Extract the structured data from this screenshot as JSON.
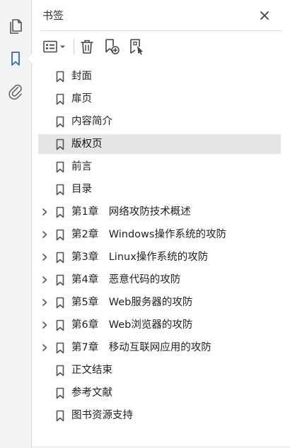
{
  "panel": {
    "title": "书签"
  },
  "icons": {
    "rail": [
      "pages-icon",
      "bookmark-icon",
      "attachment-icon"
    ],
    "close": "close-icon",
    "toolbar": [
      "options-icon",
      "delete-icon",
      "new-bookmark-icon",
      "new-bookmark-from-structure-icon"
    ]
  },
  "colors": {
    "accent": "#2b6fb6",
    "selected_row": "#e5e5e5",
    "icon": "#555555"
  },
  "bookmarks": [
    {
      "label": "封面",
      "expandable": false,
      "selected": false
    },
    {
      "label": "扉页",
      "expandable": false,
      "selected": false
    },
    {
      "label": "内容简介",
      "expandable": false,
      "selected": false
    },
    {
      "label": "版权页",
      "expandable": false,
      "selected": true
    },
    {
      "label": "前言",
      "expandable": false,
      "selected": false
    },
    {
      "label": "目录",
      "expandable": false,
      "selected": false
    },
    {
      "label": "第1章　网络攻防技术概述",
      "expandable": true,
      "selected": false
    },
    {
      "label": "第2章　Windows操作系统的攻防",
      "expandable": true,
      "selected": false
    },
    {
      "label": "第3章　Linux操作系统的攻防",
      "expandable": true,
      "selected": false
    },
    {
      "label": "第4章　恶意代码的攻防",
      "expandable": true,
      "selected": false
    },
    {
      "label": "第5章　Web服务器的攻防",
      "expandable": true,
      "selected": false
    },
    {
      "label": "第6章　Web浏览器的攻防",
      "expandable": true,
      "selected": false
    },
    {
      "label": "第7章　移动互联网应用的攻防",
      "expandable": true,
      "selected": false
    },
    {
      "label": "正文结束",
      "expandable": false,
      "selected": false
    },
    {
      "label": "参考文献",
      "expandable": false,
      "selected": false
    },
    {
      "label": "图书资源支持",
      "expandable": false,
      "selected": false
    }
  ]
}
